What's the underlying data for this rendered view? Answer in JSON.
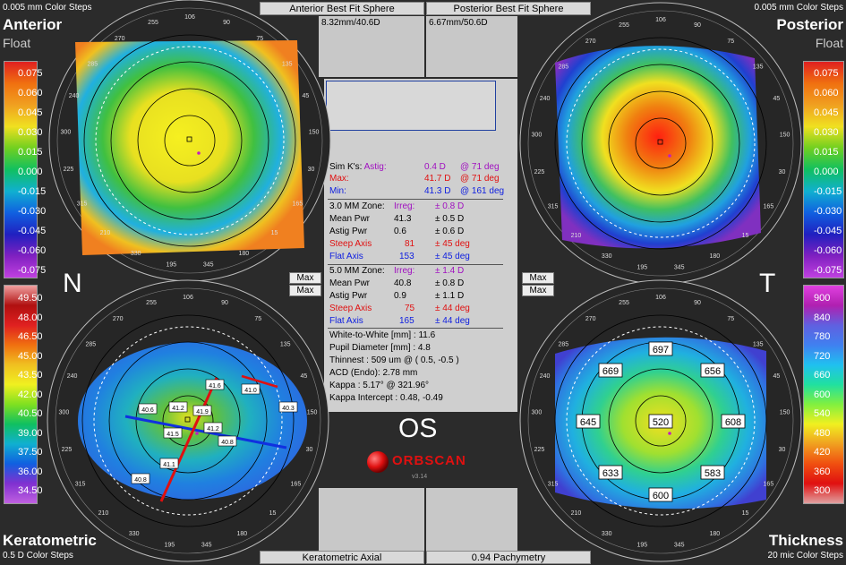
{
  "header": {
    "tl_steps": "0.005 mm Color Steps",
    "tl_title": "Anterior",
    "tl_sub": "Float",
    "tr_steps": "0.005 mm Color Steps",
    "tr_title": "Posterior",
    "tr_sub": "Float",
    "bl_title": "Keratometric",
    "bl_steps": "0.5 D Color Steps",
    "br_title": "Thickness",
    "br_steps": "20 mic Color Steps"
  },
  "tabs": {
    "anterior_bfs": "Anterior Best Fit Sphere",
    "posterior_bfs": "Posterior Best Fit Sphere",
    "anterior_val": "8.32mm/40.6D",
    "posterior_val": "6.67mm/50.6D",
    "kerato_axial": "Keratometric Axial",
    "pachymetry": "0.94 Pachymetry"
  },
  "orientation": {
    "left": "N",
    "right": "T",
    "eye": "OS"
  },
  "max_buttons": [
    "Max",
    "Max",
    "Max",
    "Max"
  ],
  "scales": {
    "float": [
      "0.075",
      "0.060",
      "0.045",
      "0.030",
      "0.015",
      "0.000",
      "-0.015",
      "-0.030",
      "-0.045",
      "-0.060",
      "-0.075"
    ],
    "kerato": [
      "49.50",
      "48.00",
      "46.50",
      "45.00",
      "43.50",
      "42.00",
      "40.50",
      "39.00",
      "37.50",
      "36.00",
      "34.50"
    ],
    "thick": [
      "900",
      "840",
      "780",
      "720",
      "660",
      "600",
      "540",
      "480",
      "420",
      "360",
      "300"
    ]
  },
  "simk": {
    "label": "Sim K's:",
    "astig_lbl": "Astig:",
    "astig_val": "0.4 D",
    "astig_deg": "@ 71 deg",
    "max_lbl": "Max:",
    "max_val": "41.7 D",
    "max_deg": "@ 71 deg",
    "min_lbl": "Min:",
    "min_val": "41.3 D",
    "min_deg": "@ 161 deg"
  },
  "zone3": {
    "title": "3.0 MM Zone:",
    "irreg_lbl": "Irreg:",
    "irreg_val": "± 0.8 D",
    "mean_lbl": "Mean Pwr",
    "mean_val": "41.3",
    "mean_pm": "± 0.5 D",
    "astig_lbl": "Astig Pwr",
    "astig_val": "0.6",
    "astig_pm": "± 0.6 D",
    "steep_lbl": "Steep Axis",
    "steep_val": "81",
    "steep_pm": "± 45 deg",
    "flat_lbl": "Flat Axis",
    "flat_val": "153",
    "flat_pm": "± 45 deg"
  },
  "zone5": {
    "title": "5.0 MM Zone:",
    "irreg_lbl": "Irreg:",
    "irreg_val": "± 1.4 D",
    "mean_lbl": "Mean Pwr",
    "mean_val": "40.8",
    "mean_pm": "± 0.8 D",
    "astig_lbl": "Astig Pwr",
    "astig_val": "0.9",
    "astig_pm": "± 1.1 D",
    "steep_lbl": "Steep Axis",
    "steep_val": "75",
    "steep_pm": "± 44 deg",
    "flat_lbl": "Flat Axis",
    "flat_val": "165",
    "flat_pm": "± 44 deg"
  },
  "measurements": {
    "wtw": "White-to-White [mm] : 11.6",
    "pupil": "Pupil Diameter [mm] :  4.8",
    "thinnest": "Thinnest : 509 um @ ( 0.5, -0.5 )",
    "acd": "ACD (Endo): 2.78 mm",
    "kappa": "Kappa : 5.17° @ 321.96°",
    "kappa_int": "Kappa Intercept : 0.48, -0.49"
  },
  "brand": {
    "name": "ORBSCAN",
    "version": "v3.14"
  },
  "pachy_values": [
    "697",
    "669",
    "656",
    "645",
    "520",
    "608",
    "633",
    "583",
    "600"
  ],
  "kerato_values": [
    "41.6",
    "41.0",
    "40.6",
    "41.2",
    "41.9",
    "40.3",
    "41.5",
    "41.2",
    "40.8",
    "41.1",
    "40.8"
  ],
  "compass": [
    "106",
    "90",
    "75",
    "135",
    "45",
    "150",
    "30",
    "165",
    "15",
    "180",
    "345",
    "195",
    "330",
    "210",
    "315",
    "225",
    "300",
    "240",
    "285",
    "270",
    "255"
  ],
  "colors": {
    "bg": "#2b2b2b",
    "panel": "#cfcfcf"
  }
}
